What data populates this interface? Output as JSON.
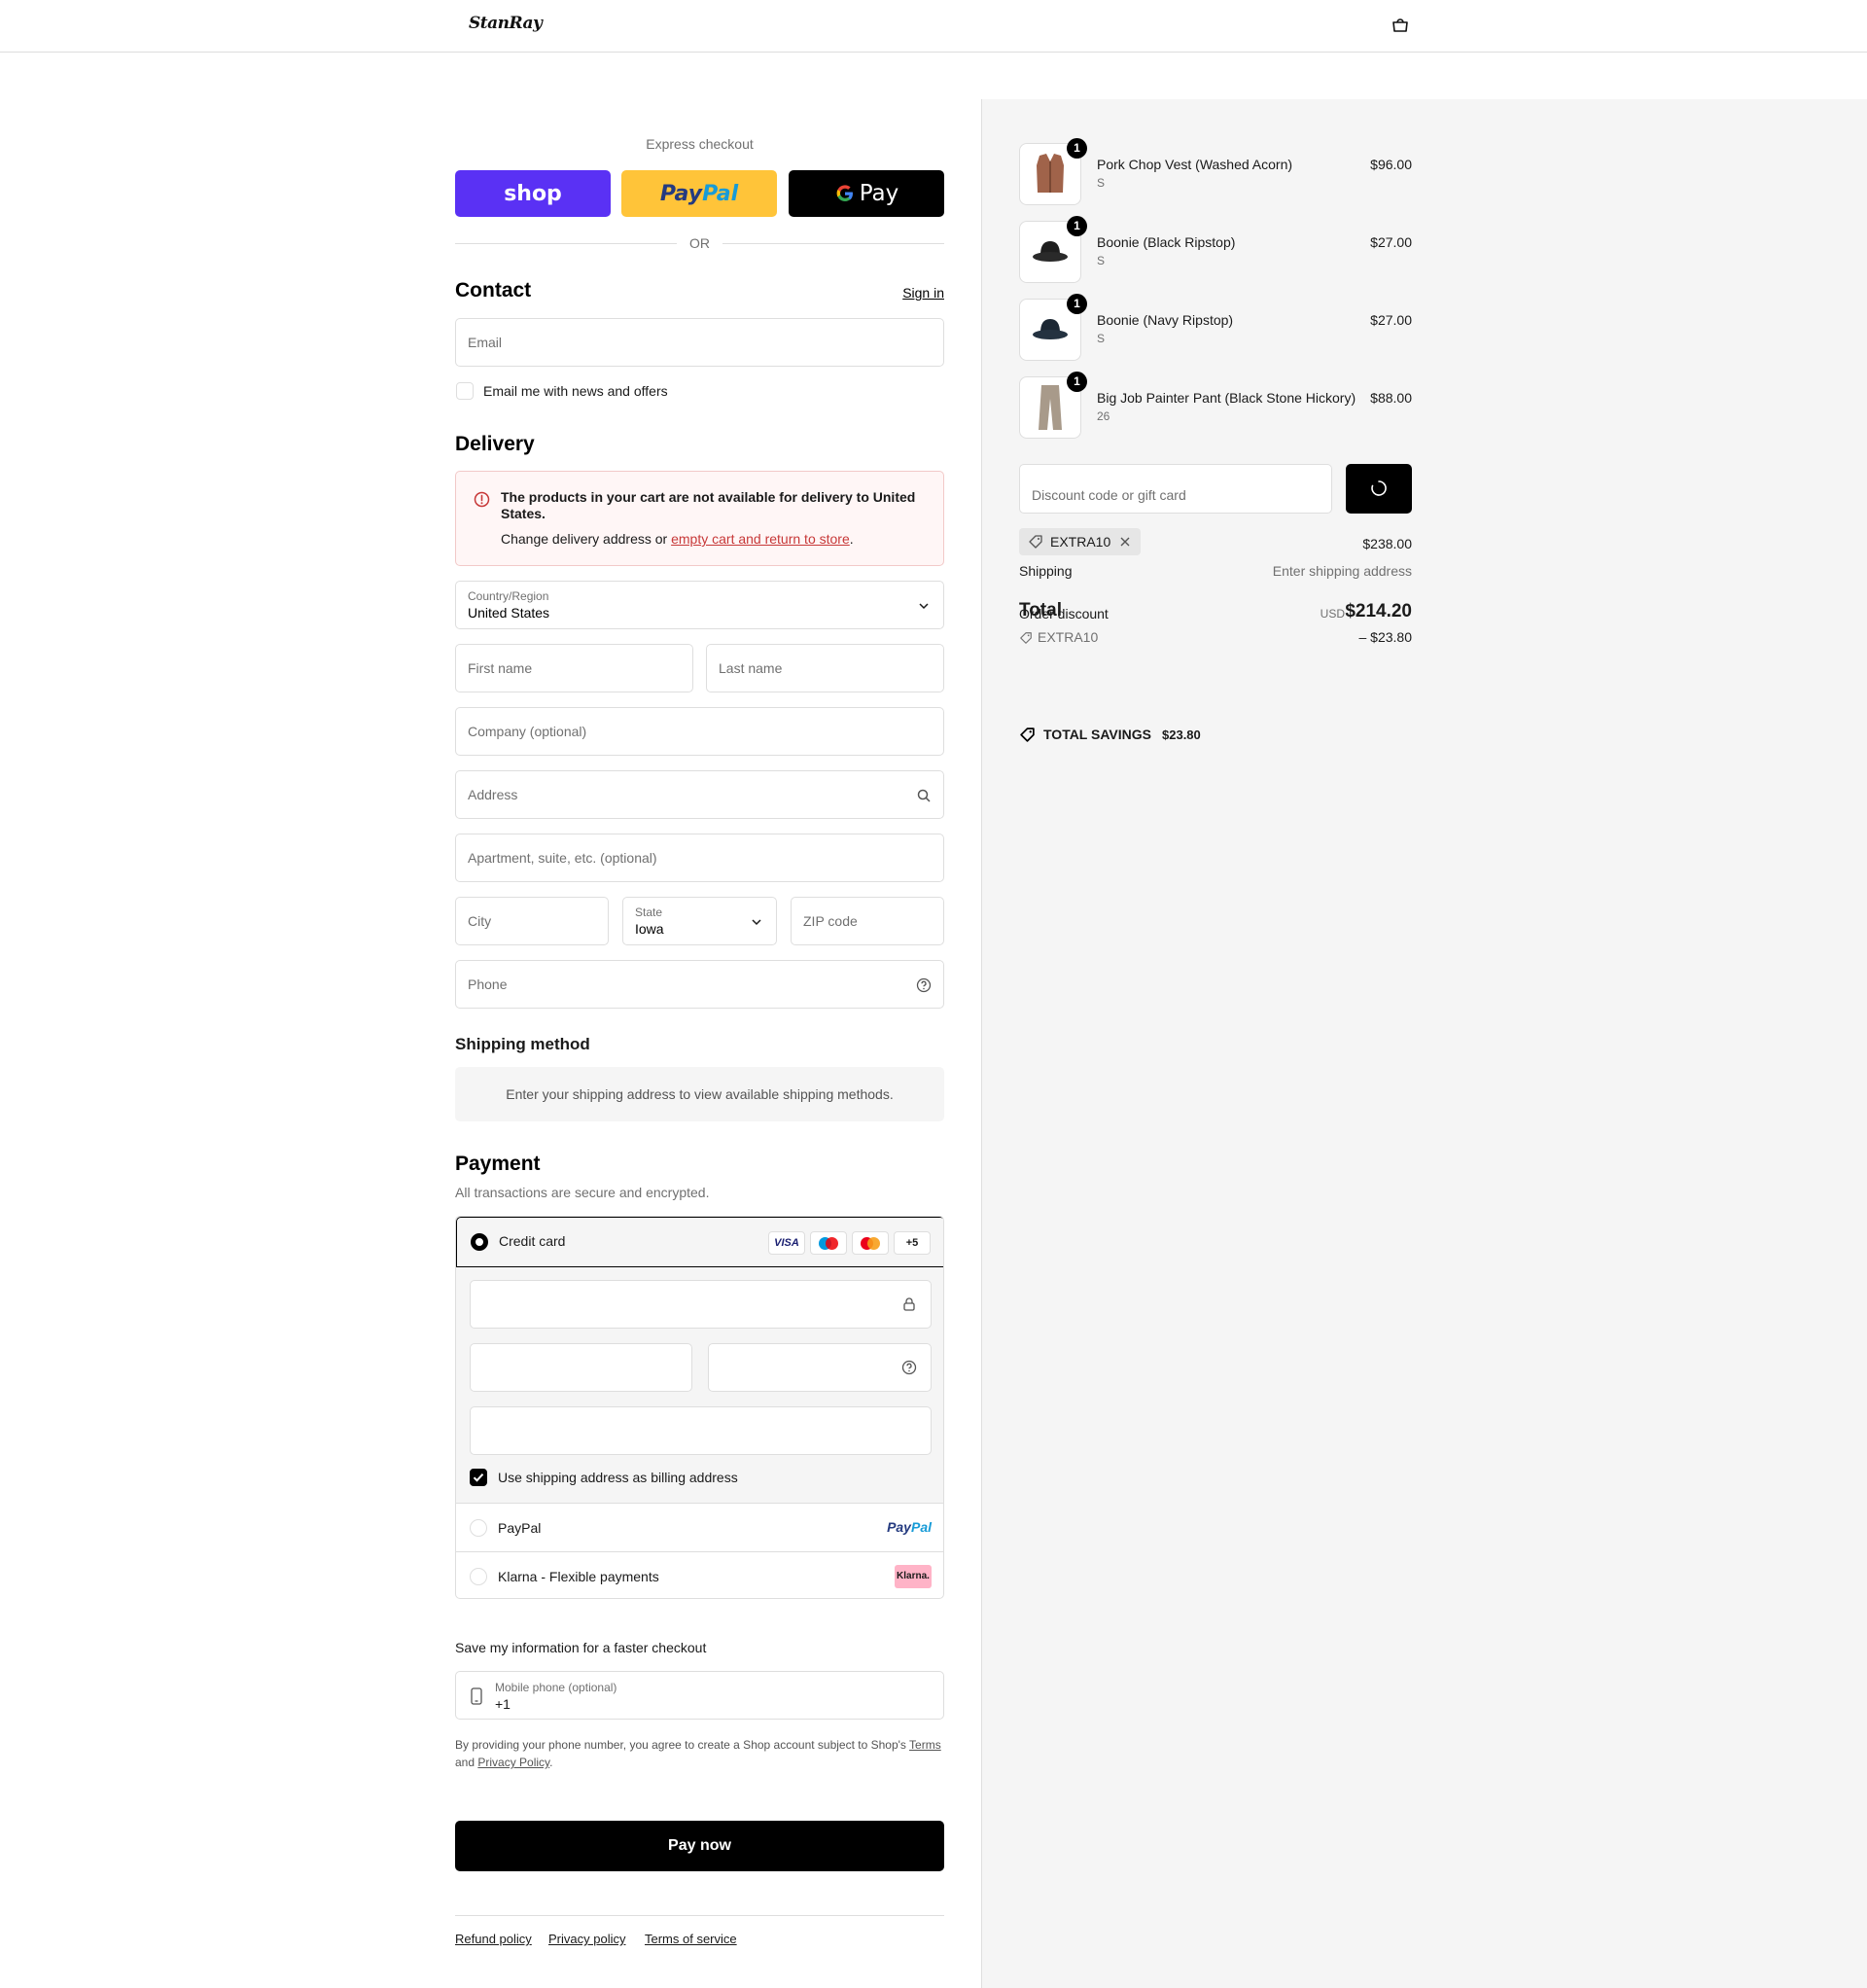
{
  "header": {
    "logo_text": "StanRay",
    "cart_icon": "bag-icon"
  },
  "express": {
    "label": "Express checkout",
    "shop_label": "shop",
    "paypal_label_1": "Pay",
    "paypal_label_2": "Pal",
    "gpay_label": "Pay",
    "or_label": "OR"
  },
  "contact": {
    "heading": "Contact",
    "sign_in": "Sign in",
    "email_placeholder": "Email",
    "newsletter_label": "Email me with news and offers"
  },
  "delivery": {
    "heading": "Delivery",
    "alert_title": "The products in your cart are not available for delivery to United States.",
    "alert_body_prefix": "Change delivery address or ",
    "alert_link": "empty cart and return to store",
    "alert_body_suffix": ".",
    "country_label": "Country/Region",
    "country_value": "United States",
    "first_name": "First name",
    "last_name": "Last name",
    "company": "Company (optional)",
    "address": "Address",
    "apartment": "Apartment, suite, etc. (optional)",
    "city": "City",
    "state_label": "State",
    "state_value": "Iowa",
    "zip": "ZIP code",
    "phone": "Phone"
  },
  "shipping_method": {
    "heading": "Shipping method",
    "message": "Enter your shipping address to view available shipping methods."
  },
  "payment": {
    "heading": "Payment",
    "subtitle": "All transactions are secure and encrypted.",
    "credit_card_label": "Credit card",
    "brands": [
      "VISA",
      "",
      "",
      "+5"
    ],
    "billing_label": "Use shipping address as billing address",
    "paypal_label": "PayPal",
    "paypal_logo_1": "Pay",
    "paypal_logo_2": "Pal",
    "klarna_label": "Klarna - Flexible payments",
    "klarna_logo": "Klarna."
  },
  "save_info": {
    "heading": "Save my information for a faster checkout",
    "mobile_label": "Mobile phone (optional)",
    "mobile_value": "+1",
    "legal_prefix": "By providing your phone number, you agree to create a Shop account subject to Shop's ",
    "legal_terms": "Terms",
    "legal_and": "and ",
    "legal_privacy": "Privacy Policy",
    "legal_suffix": "."
  },
  "pay_now": "Pay now",
  "footer": {
    "refund": "Refund policy",
    "privacy": "Privacy policy",
    "terms": "Terms of service"
  },
  "order": {
    "items": [
      {
        "name": "Pork Chop Vest (Washed Acorn)",
        "variant": "S",
        "price": "$96.00",
        "qty": "1",
        "color": "#a0634a"
      },
      {
        "name": "Boonie (Black Ripstop)",
        "variant": "S",
        "price": "$27.00",
        "qty": "1",
        "color": "#1f1f1f"
      },
      {
        "name": "Boonie (Navy Ripstop)",
        "variant": "S",
        "price": "$27.00",
        "qty": "1",
        "color": "#1c2733"
      },
      {
        "name": "Big Job Painter Pant (Black Stone Hickory)",
        "variant": "26",
        "price": "$88.00",
        "qty": "1",
        "color": "#a89a8a"
      }
    ],
    "discount_placeholder": "Discount code or gift card",
    "applied_code": "EXTRA10",
    "subtotal_value": "$238.00",
    "shipping_label": "Shipping",
    "shipping_value": "Enter shipping address",
    "order_discount_label": "Order discount",
    "total_label": "Total",
    "currency": "USD",
    "total_value": "$214.20",
    "discount_code": "EXTRA10",
    "discount_value": "– $23.80",
    "savings_label": "TOTAL SAVINGS",
    "savings_value": "$23.80"
  }
}
